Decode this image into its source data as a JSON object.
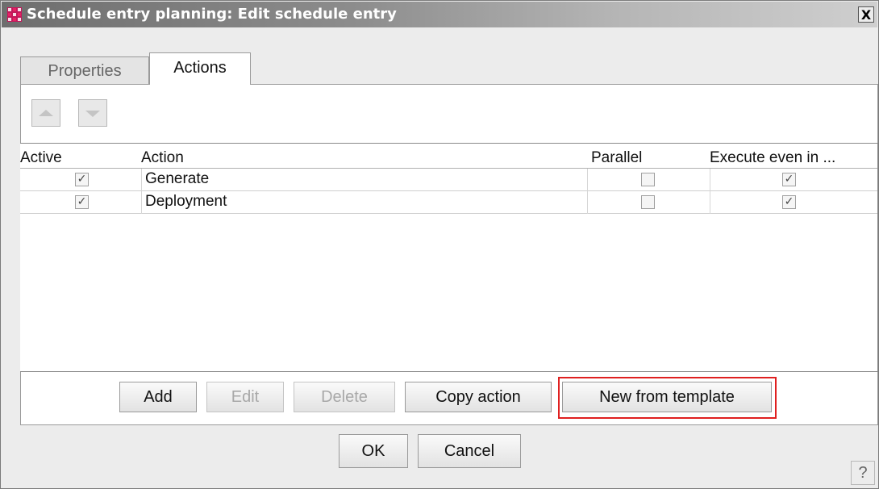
{
  "window": {
    "title": "Schedule entry planning: Edit schedule entry",
    "close_label": "X"
  },
  "tabs": [
    {
      "label": "Properties",
      "active": false
    },
    {
      "label": "Actions",
      "active": true
    }
  ],
  "toolbar": {
    "move_up_icon": "arrow-up-icon",
    "move_down_icon": "arrow-down-icon"
  },
  "table": {
    "columns": [
      "Active",
      "Action",
      "Parallel",
      "Execute even in ..."
    ],
    "rows": [
      {
        "active": true,
        "action": "Generate",
        "parallel": false,
        "execute_even": true
      },
      {
        "active": true,
        "action": "Deployment",
        "parallel": false,
        "execute_even": true
      }
    ]
  },
  "action_buttons": {
    "add": "Add",
    "edit": "Edit",
    "delete": "Delete",
    "copy": "Copy action",
    "new_from_template": "New from template"
  },
  "dialog_buttons": {
    "ok": "OK",
    "cancel": "Cancel",
    "help": "?"
  },
  "colors": {
    "highlight": "#e02020",
    "accent": "#c2185b"
  }
}
